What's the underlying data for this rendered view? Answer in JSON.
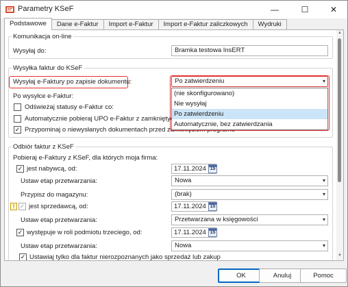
{
  "window": {
    "title": "Parametry KSeF",
    "minimize_glyph": "—",
    "maximize_glyph": "☐",
    "close_glyph": "✕"
  },
  "tabs": [
    {
      "label": "Podstawowe",
      "active": true
    },
    {
      "label": "Dane e-Faktur",
      "active": false
    },
    {
      "label": "Import e-Faktur",
      "active": false
    },
    {
      "label": "Import e-Faktur zaliczkowych",
      "active": false
    },
    {
      "label": "Wydruki",
      "active": false
    }
  ],
  "online": {
    "legend": "Komunikacja on-line",
    "send_to_label": "Wysyłaj do:",
    "send_to_value": "Bramka testowa InsERT"
  },
  "sending": {
    "legend": "Wysyłka faktur do KSeF",
    "after_save_label": "Wysyłaj e-Faktury po zapisie dokumentu:",
    "after_save_value": "Po zatwierdzeniu",
    "after_send_label": "Po wysyłce e-Faktur:",
    "refresh_status_label": "Odświeżaj statusy e-Faktur co:",
    "refresh_status_checked": false,
    "auto_upo_label": "Automatycznie pobieraj UPO e-Faktur z zamkniętych se",
    "auto_upo_checked": false,
    "remind_label": "Przypominaj o niewysłanych dokumentach przed zamknięciem programu",
    "remind_checked": true,
    "dropdown_options": [
      {
        "label": "(nie skonfigurowano)",
        "selected": false
      },
      {
        "label": "Nie wysyłaj",
        "selected": false
      },
      {
        "label": "Po zatwierdzeniu",
        "selected": true
      },
      {
        "label": "Automatycznie, bez zatwierdzania",
        "selected": false
      }
    ]
  },
  "receiving": {
    "legend": "Odbiór faktur z KSeF",
    "intro": "Pobieraj e-Faktury z KSeF, dla których moja firma:",
    "buyer_label": "jest nabywcą, od:",
    "buyer_checked": true,
    "buyer_date": "17.11.2024",
    "buyer_stage_label": "Ustaw etap przetwarzania:",
    "buyer_stage_value": "Nowa",
    "warehouse_label": "Przypisz do magazynu:",
    "warehouse_value": "(brak)",
    "seller_label": "jest sprzedawcą, od:",
    "seller_checked": true,
    "seller_date": "17.11.2024",
    "seller_stage_label": "Ustaw etap przetwarzania:",
    "seller_stage_value": "Przetwarzana w księgowości",
    "third_label": "występuje w roli podmiotu trzeciego, od:",
    "third_checked": true,
    "third_date": "17.11.2024",
    "third_stage_label": "Ustaw etap przetwarzania:",
    "third_stage_value": "Nowa",
    "unrecognized_label": "Ustawiaj tylko dla faktur nierozpoznanych jako sprzedaż lub zakup",
    "unrecognized_checked": true,
    "cal_glyph": "15",
    "warn_glyph": "!"
  },
  "buttons": {
    "ok": "OK",
    "cancel": "Anuluj",
    "help": "Pomoc"
  },
  "colors": {
    "highlight_red": "#e03030",
    "selection_blue": "#cce4f7",
    "primary_border": "#0067c0"
  },
  "icons": {
    "app": "ksef-app-icon",
    "calendar": "calendar-icon",
    "warning": "warning-icon",
    "dropdown": "chevron-down-icon"
  }
}
